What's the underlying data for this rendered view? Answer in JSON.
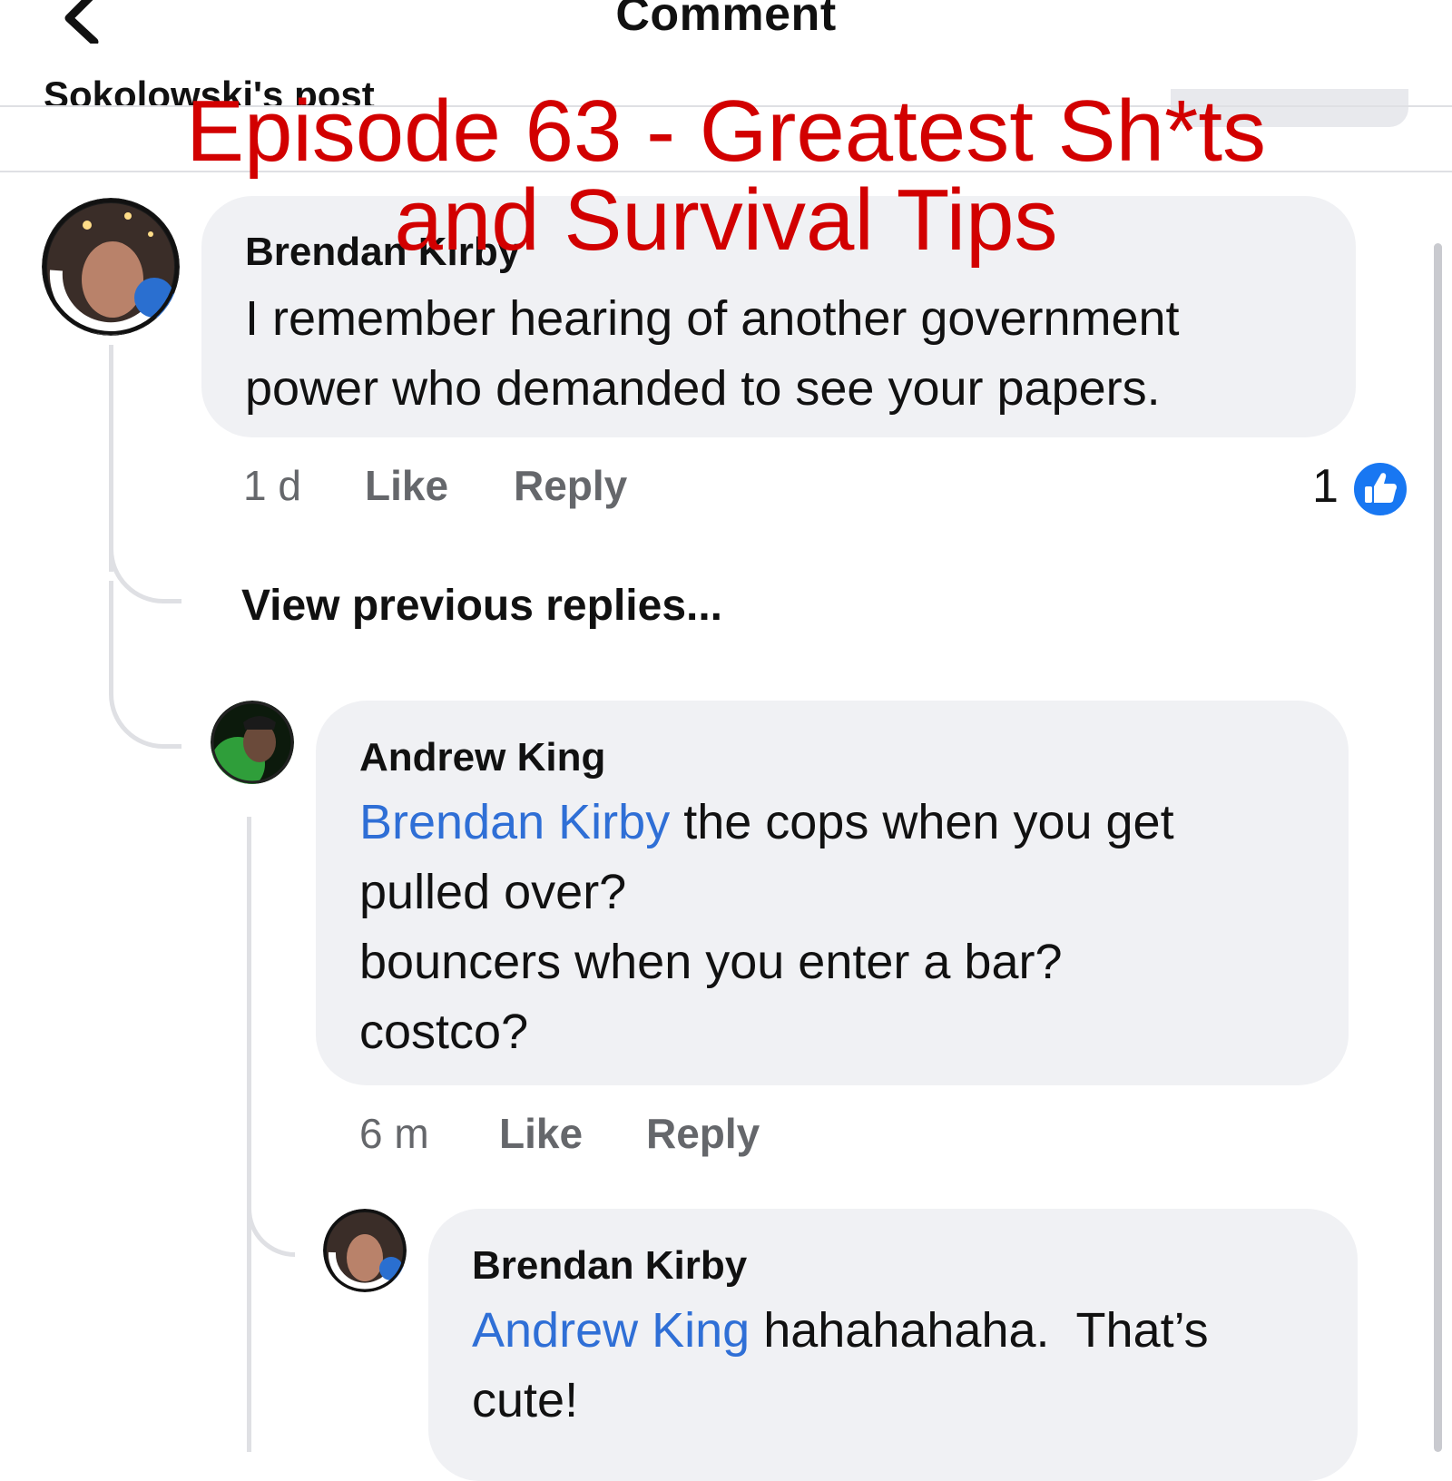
{
  "header": {
    "title": "Comment",
    "back_icon": "chevron-left-icon",
    "context": "Sokolowski's post"
  },
  "overlay": {
    "title_line1": "Episode 63 - Greatest Sh*ts",
    "title_line2": "and Survival Tips"
  },
  "comments": [
    {
      "author": "Brendan Kirby",
      "text_line1": "I remember hearing of another government",
      "text_line2": "power who demanded to see your papers.",
      "time": "1 d",
      "like_label": "Like",
      "reply_label": "Reply",
      "like_count": "1"
    }
  ],
  "view_previous": "View previous replies...",
  "replies": [
    {
      "author": "Andrew King",
      "mention": "Brendan Kirby",
      "text_line1_rest": " the cops when you get",
      "text_line2": "pulled over?",
      "text_line3": "bouncers when you enter a bar?",
      "text_line4": "costco?",
      "time": "6 m",
      "like_label": "Like",
      "reply_label": "Reply"
    },
    {
      "author": "Brendan Kirby",
      "mention": "Andrew King",
      "text_line1_rest": " hahahahaha.  That’s",
      "text_line2": "cute!"
    }
  ],
  "colors": {
    "overlay_red": "#d20000",
    "mention_blue": "#2f6fd6",
    "like_blue": "#1877f2",
    "bubble_gray": "#f0f1f4"
  }
}
